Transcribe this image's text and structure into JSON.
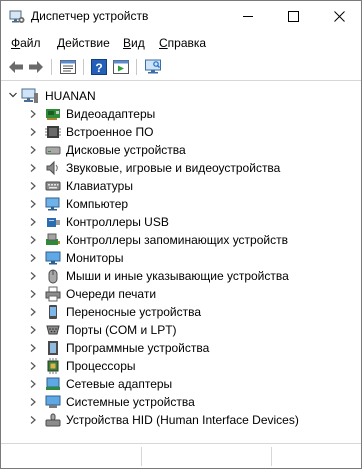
{
  "window": {
    "title": "Диспетчер устройств"
  },
  "menu": [
    {
      "label": "Файл",
      "key": "Ф",
      "rest": "айл"
    },
    {
      "label": "Действие",
      "key": "Д",
      "rest": "ействие"
    },
    {
      "label": "Вид",
      "key": "В",
      "rest": "ид"
    },
    {
      "label": "Справка",
      "key": "С",
      "rest": "правка"
    }
  ],
  "toolbar": {
    "buttons": [
      "back-arrow-icon",
      "forward-arrow-icon",
      "properties-icon",
      "help-icon",
      "run-icon",
      "monitor-scan-icon"
    ]
  },
  "tree": {
    "root": {
      "label": "HUANAN",
      "icon": "computer-icon"
    },
    "items": [
      {
        "label": "Видеоадаптеры",
        "icon": "display-adapter-icon"
      },
      {
        "label": "Встроенное ПО",
        "icon": "firmware-icon"
      },
      {
        "label": "Дисковые устройства",
        "icon": "disk-drive-icon"
      },
      {
        "label": "Звуковые, игровые и видеоустройства",
        "icon": "speaker-icon"
      },
      {
        "label": "Клавиатуры",
        "icon": "keyboard-icon"
      },
      {
        "label": "Компьютер",
        "icon": "computer-icon"
      },
      {
        "label": "Контроллеры USB",
        "icon": "usb-icon"
      },
      {
        "label": "Контроллеры запоминающих устройств",
        "icon": "storage-controller-icon"
      },
      {
        "label": "Мониторы",
        "icon": "monitor-icon"
      },
      {
        "label": "Мыши и иные указывающие устройства",
        "icon": "mouse-icon"
      },
      {
        "label": "Очереди печати",
        "icon": "printer-icon"
      },
      {
        "label": "Переносные устройства",
        "icon": "portable-device-icon"
      },
      {
        "label": "Порты (COM и LPT)",
        "icon": "port-icon"
      },
      {
        "label": "Программные устройства",
        "icon": "software-device-icon"
      },
      {
        "label": "Процессоры",
        "icon": "processor-icon"
      },
      {
        "label": "Сетевые адаптеры",
        "icon": "network-adapter-icon"
      },
      {
        "label": "Системные устройства",
        "icon": "system-device-icon"
      },
      {
        "label": "Устройства HID (Human Interface Devices)",
        "icon": "hid-icon"
      }
    ]
  },
  "colors": {
    "accent": "#1e6fd0",
    "border": "#7a7a7a",
    "separator": "#d7d7d7"
  }
}
